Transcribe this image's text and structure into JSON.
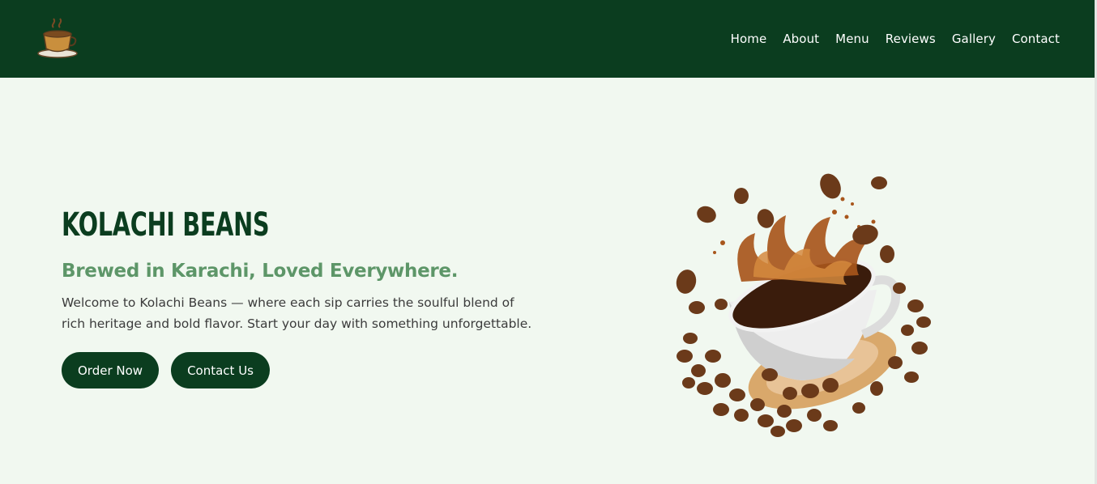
{
  "brand": {
    "logo_icon": "coffee-cup-icon",
    "name": "KOLACHI BEANS",
    "color": "#0b3d1f"
  },
  "nav": {
    "items": [
      {
        "label": "Home"
      },
      {
        "label": "About"
      },
      {
        "label": "Menu"
      },
      {
        "label": "Reviews"
      },
      {
        "label": "Gallery"
      },
      {
        "label": "Contact"
      }
    ]
  },
  "hero": {
    "title": "KOLACHI BEANS",
    "tagline": "Brewed in Karachi, Loved Everywhere.",
    "description": "Welcome to Kolachi Beans — where each sip carries the soulful blend of rich heritage and bold flavor. Start your day with something unforgettable.",
    "buttons": {
      "order": "Order Now",
      "contact": "Contact Us"
    },
    "image_icon": "coffee-cup-splash-image"
  },
  "colors": {
    "primary": "#0b3d1f",
    "accent": "#5d9668",
    "background": "#f1f8f0",
    "text": "#3b3b3b"
  }
}
